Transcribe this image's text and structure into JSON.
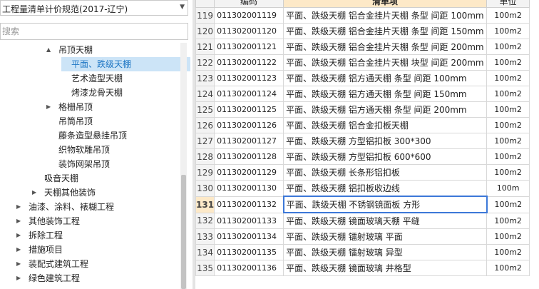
{
  "left_panel": {
    "spec_select": {
      "value": "工程量清单计价规范(2017-辽宁)"
    },
    "search": {
      "placeholder": "搜索"
    },
    "tree": [
      {
        "label": "吊顶天棚",
        "toggle": "▲",
        "indent": 82,
        "expanded": true
      },
      {
        "label": "平面、跌级天棚",
        "toggle": "",
        "indent": 100,
        "selected": true
      },
      {
        "label": "艺术造型天棚",
        "toggle": "",
        "indent": 100
      },
      {
        "label": "烤漆龙骨天棚",
        "toggle": "",
        "indent": 100
      },
      {
        "label": "格栅吊顶",
        "toggle": "▶",
        "indent": 82
      },
      {
        "label": "吊筒吊顶",
        "toggle": "",
        "indent": 82
      },
      {
        "label": "藤条造型悬挂吊顶",
        "toggle": "",
        "indent": 82
      },
      {
        "label": "织物软雕吊顶",
        "toggle": "",
        "indent": 82
      },
      {
        "label": "装饰网架吊顶",
        "toggle": "",
        "indent": 82
      },
      {
        "label": "吸音天棚",
        "toggle": "",
        "indent": 62
      },
      {
        "label": "天棚其他装饰",
        "toggle": "▶",
        "indent": 62
      },
      {
        "label": "油漆、涂料、裱糊工程",
        "toggle": "▶",
        "indent": 40
      },
      {
        "label": "其他装饰工程",
        "toggle": "▶",
        "indent": 40
      },
      {
        "label": "拆除工程",
        "toggle": "▶",
        "indent": 40
      },
      {
        "label": "措施项目",
        "toggle": "▶",
        "indent": 40
      },
      {
        "label": "装配式建筑工程",
        "toggle": "▶",
        "indent": 40
      },
      {
        "label": "绿色建筑工程",
        "toggle": "▶",
        "indent": 40
      }
    ]
  },
  "grid": {
    "headers": {
      "code": "编码",
      "name": "清单项",
      "unit": "单位"
    },
    "rows": [
      {
        "no": "119",
        "code": "011302001119",
        "name": "平面、跌级天棚 铝合金挂片天棚 条型 间距 100mm",
        "unit": "100m2"
      },
      {
        "no": "120",
        "code": "011302001120",
        "name": "平面、跌级天棚 铝合金挂片天棚 条型 间距 150mm",
        "unit": "100m2"
      },
      {
        "no": "121",
        "code": "011302001121",
        "name": "平面、跌级天棚 铝合金挂片天棚 条型 间距 200mm",
        "unit": "100m2"
      },
      {
        "no": "122",
        "code": "011302001122",
        "name": "平面、跌级天棚 铝合金挂片天棚 块型 间距 200mm",
        "unit": "100m2"
      },
      {
        "no": "123",
        "code": "011302001123",
        "name": "平面、跌级天棚 铝方通天棚 条型 间距 100mm",
        "unit": "100m2"
      },
      {
        "no": "124",
        "code": "011302001124",
        "name": "平面、跌级天棚 铝方通天棚 条型 间距 150mm",
        "unit": "100m2"
      },
      {
        "no": "125",
        "code": "011302001125",
        "name": "平面、跌级天棚 铝方通天棚 条型 间距 200mm",
        "unit": "100m2"
      },
      {
        "no": "126",
        "code": "011302001126",
        "name": "平面、跌级天棚 铝合金扣板天棚",
        "unit": "100m2"
      },
      {
        "no": "127",
        "code": "011302001127",
        "name": "平面、跌级天棚 方型铝扣板 300*300",
        "unit": "100m2"
      },
      {
        "no": "128",
        "code": "011302001128",
        "name": "平面、跌级天棚 方型铝扣板 600*600",
        "unit": "100m2"
      },
      {
        "no": "129",
        "code": "011302001129",
        "name": "平面、跌级天棚 长条形铝扣板",
        "unit": "100m2"
      },
      {
        "no": "130",
        "code": "011302001130",
        "name": "平面、跌级天棚 铝扣板收边线",
        "unit": "100m"
      },
      {
        "no": "131",
        "code": "011302001132",
        "name": "平面、跌级天棚 不锈钢镜面板 方形",
        "unit": "100m2",
        "current": true
      },
      {
        "no": "132",
        "code": "011302001133",
        "name": "平面、跌级天棚 镜面玻璃天棚 平缝",
        "unit": "100m2"
      },
      {
        "no": "133",
        "code": "011302001134",
        "name": "平面、跌级天棚 镭射玻璃 平面",
        "unit": "100m2"
      },
      {
        "no": "134",
        "code": "011302001135",
        "name": "平面、跌级天棚 镭射玻璃 异型",
        "unit": "100m2"
      },
      {
        "no": "135",
        "code": "011302001136",
        "name": "平面、跌级天棚 镜面玻璃 井格型",
        "unit": "100m2"
      }
    ]
  }
}
